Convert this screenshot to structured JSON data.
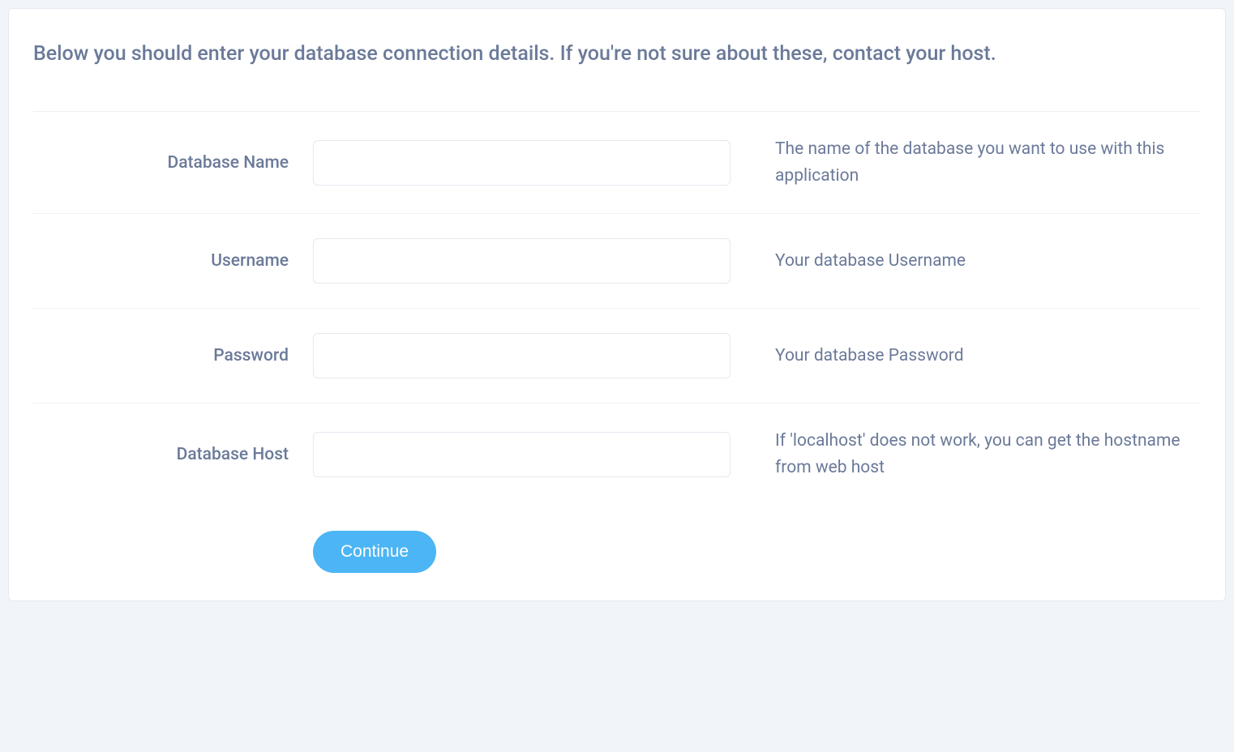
{
  "intro": "Below you should enter your database connection details. If you're not sure about these, contact your host.",
  "fields": {
    "database_name": {
      "label": "Database Name",
      "value": "",
      "help": "The name of the database you want to use with this application"
    },
    "username": {
      "label": "Username",
      "value": "",
      "help": "Your database Username"
    },
    "password": {
      "label": "Password",
      "value": "",
      "help": "Your database Password"
    },
    "database_host": {
      "label": "Database Host",
      "value": "",
      "help": "If 'localhost' does not work, you can get the hostname from web host"
    }
  },
  "action": {
    "continue_label": "Continue"
  }
}
